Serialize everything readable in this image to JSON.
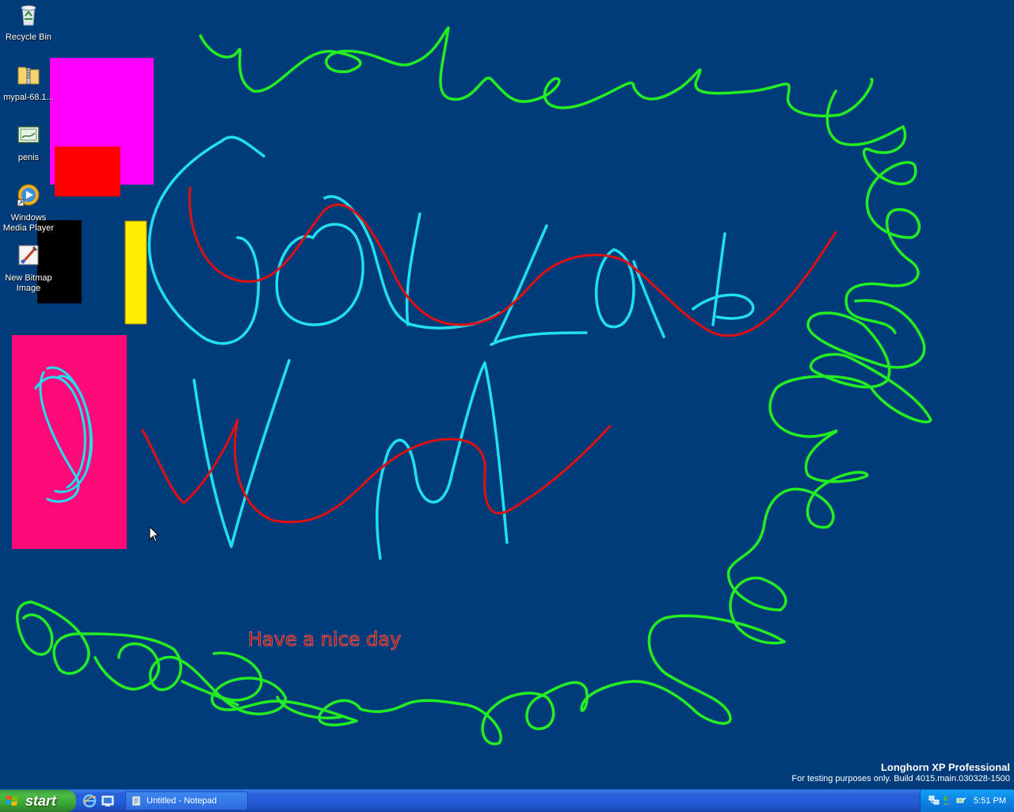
{
  "desktop": {
    "icons": [
      {
        "label": "Recycle Bin",
        "icon": "recycle-bin-icon"
      },
      {
        "label": "mypal-68.1...",
        "icon": "zip-folder-icon"
      },
      {
        "label": "penis",
        "icon": "image-file-icon"
      },
      {
        "label": "Windows Media Player",
        "icon": "windows-media-player-icon"
      },
      {
        "label": "New Bitmap Image",
        "icon": "paint-bitmap-icon"
      }
    ],
    "drawing_text": "Have a nice day",
    "colors": {
      "background": "#003b7a",
      "green": "#22ee22",
      "cyan": "#20e0f0",
      "red": "#e01010",
      "magenta": "#ff00ff",
      "pink": "#ff0a78",
      "yellow": "#ffee00"
    }
  },
  "watermark": {
    "line1": "Longhorn XP Professional",
    "line2": "For testing purposes only. Build 4015.main.030328-1500"
  },
  "taskbar": {
    "start_label": "start",
    "quick_launch": [
      "internet-explorer-icon",
      "show-desktop-icon"
    ],
    "tasks": [
      {
        "label": "Untitled - Notepad",
        "icon": "notepad-icon"
      }
    ],
    "tray_icons": [
      "network-icon",
      "msn-messenger-icon",
      "safely-remove-icon"
    ],
    "clock": "5:51 PM"
  }
}
